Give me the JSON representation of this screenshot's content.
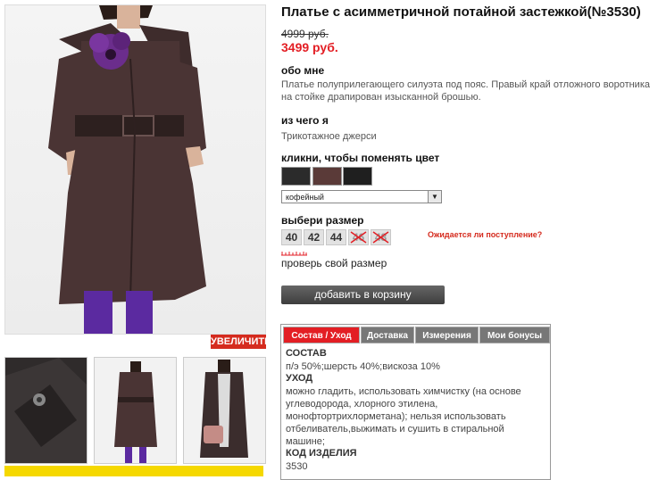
{
  "product": {
    "title": "Платье с асимметричной потайной застежкой(№3530)",
    "old_price": "4999 руб.",
    "new_price": "3499 руб."
  },
  "about": {
    "heading": "обо мне",
    "text": "Платье полуприлегающего силуэта под пояс. Правый край отложного воротника на стойке драпирован изысканной брошью."
  },
  "material": {
    "heading": "из чего я",
    "text": "Трикотажное джерси"
  },
  "color": {
    "heading": "кликни, чтобы поменять цвет",
    "selected": "кофейный",
    "swatches": [
      "#2b2b2b",
      "#5a3a38",
      "#1f1f1f"
    ]
  },
  "size": {
    "heading": "выбери размер",
    "sizes": [
      {
        "label": "40",
        "available": true
      },
      {
        "label": "42",
        "available": true
      },
      {
        "label": "44",
        "available": true
      },
      {
        "label": "46",
        "available": false
      },
      {
        "label": "48",
        "available": false
      }
    ],
    "notify": "Ожидается ли поступление?",
    "check": "проверь свой размер"
  },
  "cart_button": "добавить в корзину",
  "zoom_label": "УВЕЛИЧИТЬ",
  "tabs": [
    {
      "label": "Состав / Уход",
      "active": true
    },
    {
      "label": "Доставка",
      "active": false
    },
    {
      "label": "Измерения",
      "active": false
    },
    {
      "label": "Мои бонусы",
      "active": false
    }
  ],
  "details": {
    "composition_heading": "СОСТАВ",
    "composition": "п/э 50%;шерсть 40%;вискоза 10%",
    "care_heading": "УХОД",
    "care": "можно гладить, использовать химчистку (на основе углеводорода, хлорного этилена, монофтортрихлорметана); нельзя использовать отбеливатель,выжимать и сушить в стиральной машине;",
    "code_heading": "КОД ИЗДЕЛИЯ",
    "code": "3530"
  },
  "colors": {
    "accent": "#e31e24",
    "dress": "#4a3434",
    "tights": "#5b2aa0"
  }
}
